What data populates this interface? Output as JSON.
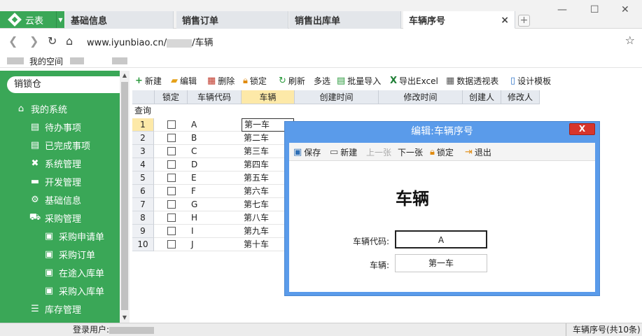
{
  "tabs": {
    "app_name": "云表",
    "items": [
      "基础信息",
      "销售订单",
      "销售出库单",
      "车辆序号"
    ],
    "new_tab": "+",
    "close_glyph": "×"
  },
  "window": {
    "minimize": "—",
    "maximize": "☐",
    "close": "✕"
  },
  "address": {
    "url_prefix": "www.iyunbiao.cn/",
    "url_suffix": "/车辆"
  },
  "bookmarks": [
    "我的空间"
  ],
  "sidebar": {
    "search": "销锁仓",
    "items": [
      {
        "label": "我的系统",
        "icon": "home-icon"
      },
      {
        "label": "待办事项",
        "icon": "list-icon"
      },
      {
        "label": "已完成事项",
        "icon": "list-icon"
      },
      {
        "label": "系统管理",
        "icon": "tools-icon"
      },
      {
        "label": "开发管理",
        "icon": "folder-icon"
      },
      {
        "label": "基础信息",
        "icon": "gear-icon"
      },
      {
        "label": "采购管理",
        "icon": "cart-icon"
      },
      {
        "label": "采购申请单",
        "icon": "doc-icon"
      },
      {
        "label": "采购订单",
        "icon": "doc-icon"
      },
      {
        "label": "在途入库单",
        "icon": "doc-icon"
      },
      {
        "label": "采购入库单",
        "icon": "doc-icon"
      },
      {
        "label": "库存管理",
        "icon": "stack-icon"
      }
    ]
  },
  "toolbar": {
    "new": "新建",
    "edit": "编辑",
    "delete": "删除",
    "lock": "锁定",
    "refresh": "刷新",
    "multi": "多选",
    "import": "批量导入",
    "export": "导出Excel",
    "pivot": "数据透视表",
    "design": "设计模板"
  },
  "grid": {
    "headers": [
      "锁定",
      "车辆代码",
      "车辆",
      "创建时间",
      "修改时间",
      "创建人",
      "修改人"
    ],
    "query_label": "查询",
    "rows": [
      {
        "n": "1",
        "code": "A",
        "name": "第一车"
      },
      {
        "n": "2",
        "code": "B",
        "name": "第二车"
      },
      {
        "n": "3",
        "code": "C",
        "name": "第三车"
      },
      {
        "n": "4",
        "code": "D",
        "name": "第四车"
      },
      {
        "n": "5",
        "code": "E",
        "name": "第五车"
      },
      {
        "n": "6",
        "code": "F",
        "name": "第六车"
      },
      {
        "n": "7",
        "code": "G",
        "name": "第七车"
      },
      {
        "n": "8",
        "code": "H",
        "name": "第八车"
      },
      {
        "n": "9",
        "code": "I",
        "name": "第九车"
      },
      {
        "n": "10",
        "code": "J",
        "name": "第十车"
      }
    ]
  },
  "modal": {
    "title": "编辑:车辆序号",
    "close": "X",
    "toolbar": {
      "save": "保存",
      "new": "新建",
      "prev": "上一张",
      "next": "下一张",
      "lock": "锁定",
      "exit": "退出"
    },
    "heading": "车辆",
    "fields": [
      {
        "label": "车辆代码:",
        "value": "A"
      },
      {
        "label": "车辆:",
        "value": "第一车"
      }
    ]
  },
  "status": {
    "login_label": "登录用户:",
    "record_info": "车辆序号(共10条)"
  },
  "colors": {
    "accent": "#3aa757",
    "modal": "#5a9bea",
    "highlight": "#fde9a8"
  }
}
